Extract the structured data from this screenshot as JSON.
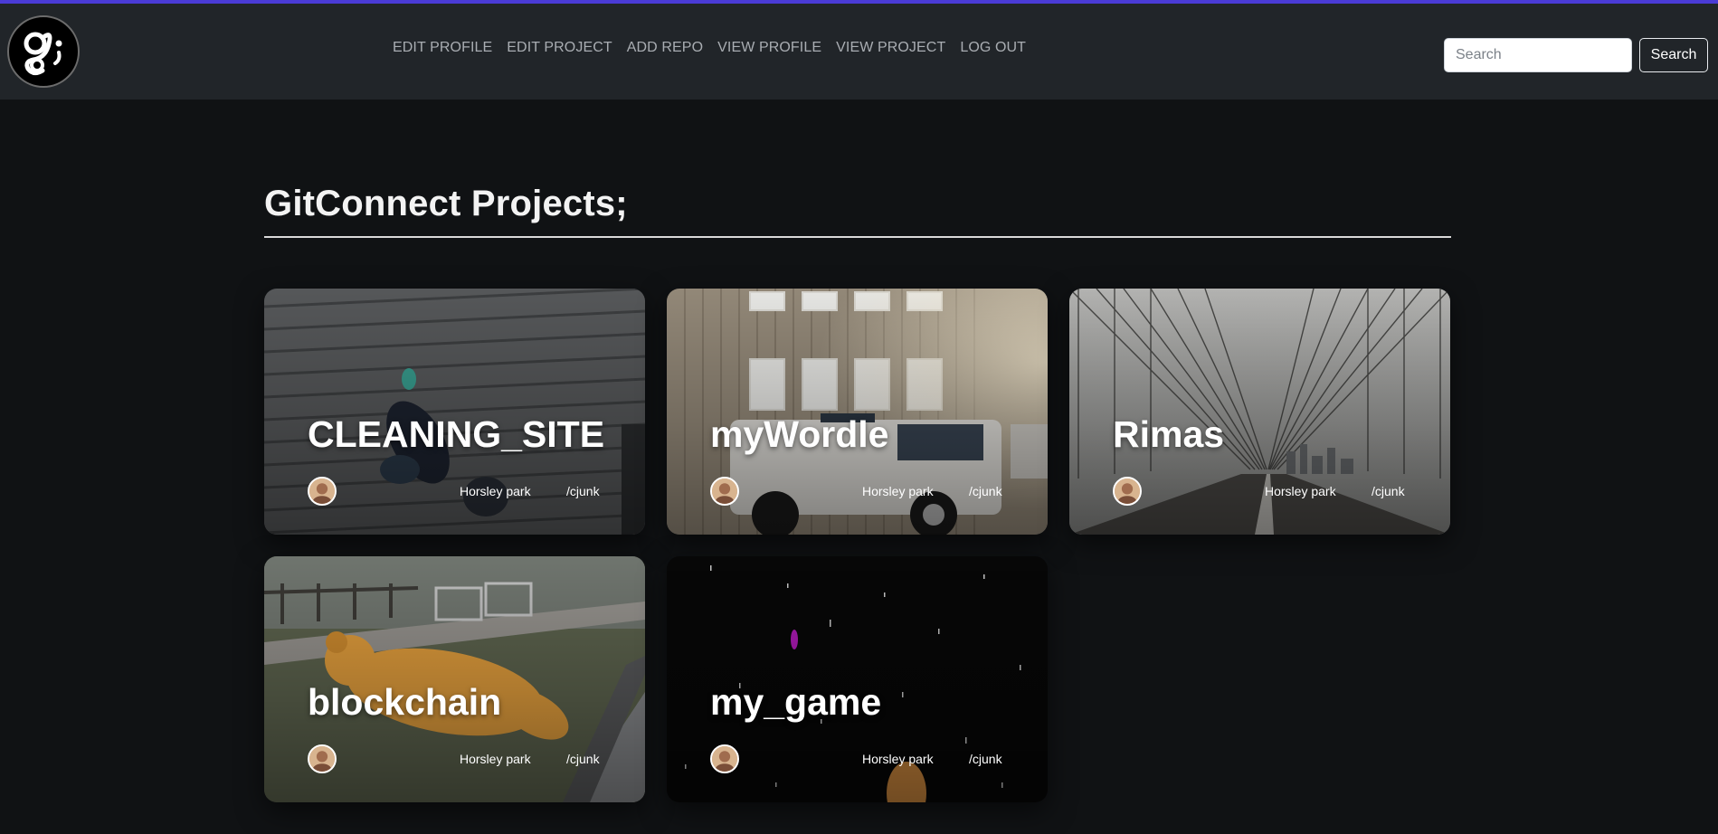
{
  "nav": {
    "logo_alt": "gc;",
    "links": [
      {
        "label": "EDIT PROFILE"
      },
      {
        "label": "EDIT PROJECT"
      },
      {
        "label": "ADD REPO"
      },
      {
        "label": "VIEW PROFILE"
      },
      {
        "label": "VIEW PROJECT"
      },
      {
        "label": "LOG OUT"
      }
    ],
    "search_placeholder": "Search",
    "search_button": "Search"
  },
  "page": {
    "title": "GitConnect Projects;"
  },
  "projects": [
    {
      "title": "CLEANING_SITE",
      "location": "Horsley park",
      "repo": "/cjunk",
      "image": "wooden-deck-people-photo"
    },
    {
      "title": "myWordle",
      "location": "Horsley park",
      "repo": "/cjunk",
      "image": "house-and-white-truck-photo"
    },
    {
      "title": "Rimas",
      "location": "Horsley park",
      "repo": "/cjunk",
      "image": "bridge-cables-photo"
    },
    {
      "title": "blockchain",
      "location": "Horsley park",
      "repo": "/cjunk",
      "image": "teddy-bear-on-grass-photo"
    },
    {
      "title": "my_game",
      "location": "Horsley park",
      "repo": "/cjunk",
      "image": "dark-space-photo"
    }
  ],
  "colors": {
    "accent_bar": "#4a3bd6",
    "navbar_bg": "#212529",
    "page_bg": "#101214"
  }
}
